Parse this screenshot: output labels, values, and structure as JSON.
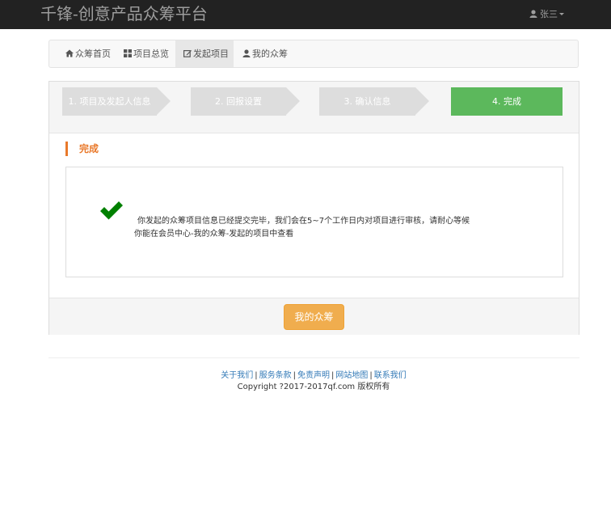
{
  "header": {
    "brand": "千锋-创意产品众筹平台",
    "user_name": "张三"
  },
  "nav": {
    "tabs": [
      {
        "label": "众筹首页"
      },
      {
        "label": "项目总览"
      },
      {
        "label": "发起项目"
      },
      {
        "label": "我的众筹"
      }
    ]
  },
  "steps": [
    {
      "label": "1. 项目及发起人信息"
    },
    {
      "label": "2. 回报设置"
    },
    {
      "label": "3. 确认信息"
    },
    {
      "label": "4. 完成"
    }
  ],
  "content": {
    "section_title": "完成",
    "message_line1": "你发起的众筹项目信息已经提交完毕，我们会在5~7个工作日内对项目进行审核，请耐心等候",
    "message_line2": "你能在会员中心-我的众筹-发起的项目中查看",
    "button_label": "我的众筹"
  },
  "footer": {
    "links": [
      {
        "label": "关于我们"
      },
      {
        "label": "服务条款"
      },
      {
        "label": "免责声明"
      },
      {
        "label": "网站地图"
      },
      {
        "label": "联系我们"
      }
    ],
    "separator": "|",
    "copyright": "Copyright ?2017-2017qf.com 版权所有"
  },
  "colors": {
    "topbar": "#222222",
    "accent_orange": "#e9792b",
    "step_done": "#5cb85c",
    "step_pending": "#dddddd",
    "button": "#f0ad4e",
    "link": "#337ab7",
    "check": "#008000"
  },
  "icons": {
    "user": "user-icon",
    "home": "home-icon",
    "grid": "grid-icon",
    "edit": "edit-icon",
    "check": "check-icon"
  }
}
